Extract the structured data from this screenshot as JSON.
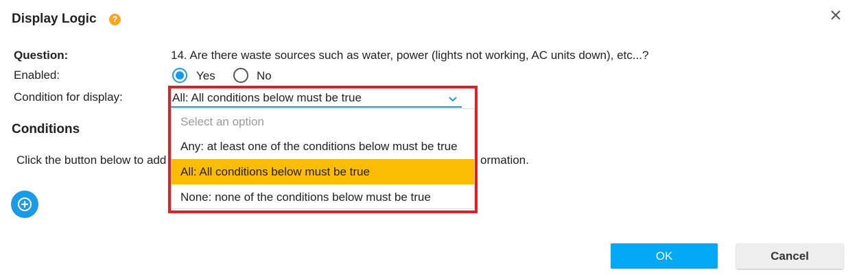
{
  "dialog": {
    "title": "Display Logic",
    "help_icon": "question-circle-icon",
    "close_icon": "close-icon"
  },
  "fields": {
    "question_label": "Question:",
    "question_text": "14. Are there waste sources such as water, power (lights not working, AC units down), etc...?",
    "enabled_label": "Enabled:",
    "enabled_options": [
      {
        "label": "Yes",
        "checked": true
      },
      {
        "label": "No",
        "checked": false
      }
    ],
    "condition_label": "Condition for display:",
    "condition_value": "All: All conditions below must be true"
  },
  "dropdown": {
    "options": [
      {
        "label": "Select an option",
        "placeholder": true
      },
      {
        "label": "Any: at least one of the conditions below must be true"
      },
      {
        "label": "All: All conditions below must be true",
        "selected": true
      },
      {
        "label": "None: none of the conditions below must be true"
      }
    ]
  },
  "conditions": {
    "title": "Conditions",
    "info_left": "Click the button below to add",
    "info_right": "ormation."
  },
  "buttons": {
    "ok": "OK",
    "cancel": "Cancel"
  },
  "colors": {
    "accent": "#1a9be8",
    "ok_button": "#03a9f4",
    "selected_option": "#fbbc04",
    "highlight": "#e31e24",
    "help_icon": "#f5a623"
  }
}
